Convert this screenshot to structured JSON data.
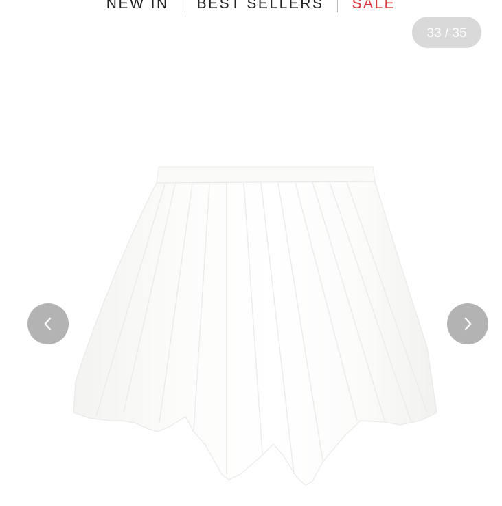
{
  "nav": {
    "items": [
      {
        "label": "NEW IN"
      },
      {
        "label": "BEST SELLERS"
      },
      {
        "label": "SALE",
        "color": "#d9363e"
      }
    ]
  },
  "gallery": {
    "counter": "33 / 35",
    "prev_icon": "chevron-left-icon",
    "next_icon": "chevron-right-icon",
    "product_image": "white-pleated-handkerchief-hem-skirt"
  }
}
